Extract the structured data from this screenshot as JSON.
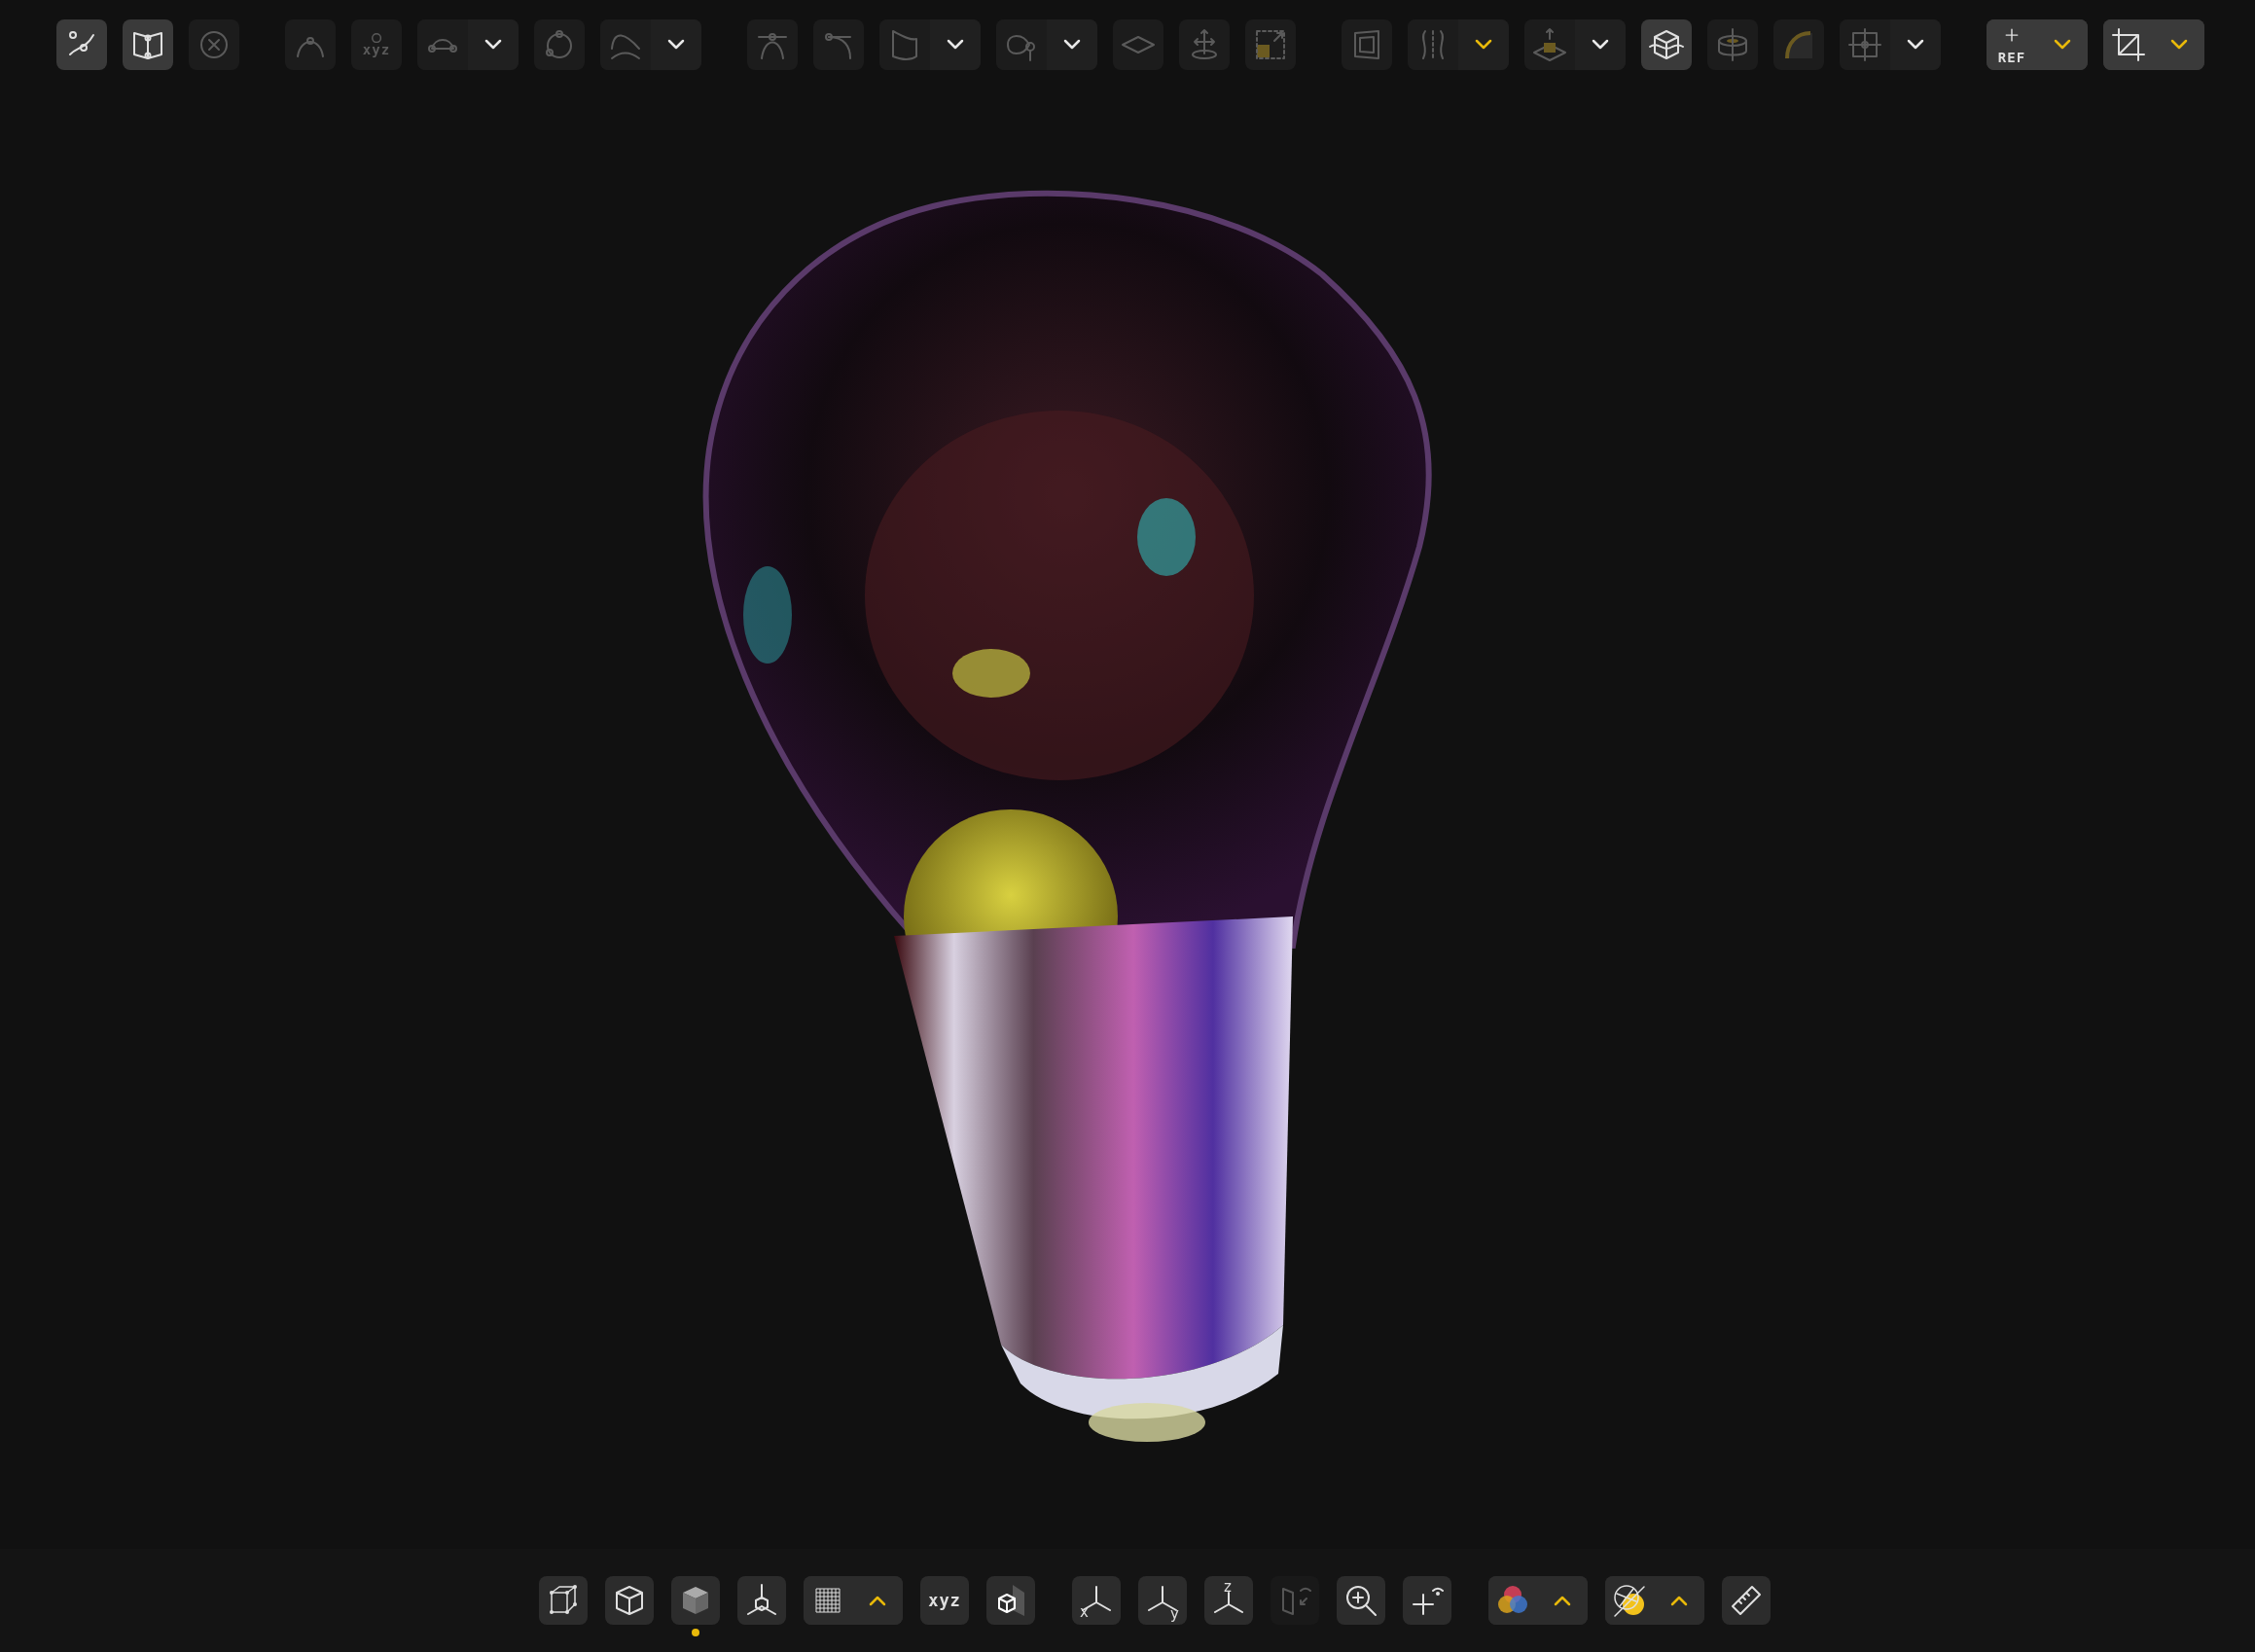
{
  "top_toolbar": {
    "groups": [
      {
        "items": [
          {
            "kind": "tool",
            "active": true
          },
          {
            "kind": "tool",
            "active": true
          },
          {
            "kind": "tool",
            "active": false
          }
        ]
      },
      {
        "items": [
          {
            "kind": "tool",
            "active": false
          },
          {
            "kind": "tool",
            "active": false,
            "label": "xyz"
          },
          {
            "kind": "split",
            "active": false,
            "accent": false
          },
          {
            "kind": "tool",
            "active": false
          },
          {
            "kind": "split",
            "active": false,
            "accent": false
          }
        ]
      },
      {
        "items": [
          {
            "kind": "tool",
            "active": false
          },
          {
            "kind": "tool",
            "active": false
          },
          {
            "kind": "split",
            "active": false,
            "accent": false
          },
          {
            "kind": "split",
            "active": false,
            "accent": false
          },
          {
            "kind": "tool",
            "active": false
          },
          {
            "kind": "tool",
            "active": false
          },
          {
            "kind": "tool",
            "active": false
          }
        ]
      },
      {
        "items": [
          {
            "kind": "tool",
            "active": false
          },
          {
            "kind": "split",
            "active": false,
            "accent": true
          },
          {
            "kind": "split",
            "active": false,
            "accent": false
          },
          {
            "kind": "tool",
            "active": true
          },
          {
            "kind": "tool",
            "active": false
          },
          {
            "kind": "tool",
            "active": false
          },
          {
            "kind": "split",
            "active": false,
            "accent": false
          }
        ]
      },
      {
        "items": [
          {
            "kind": "split",
            "active": true,
            "accent": true,
            "label": "REF"
          },
          {
            "kind": "split",
            "active": true,
            "accent": true
          }
        ]
      }
    ]
  },
  "bottom_toolbar": {
    "groups": [
      {
        "items": [
          {
            "kind": "tool",
            "selected": false,
            "disabled": false
          },
          {
            "kind": "tool",
            "selected": false,
            "disabled": false
          },
          {
            "kind": "tool",
            "selected": true,
            "disabled": false
          },
          {
            "kind": "tool",
            "selected": false,
            "disabled": false
          },
          {
            "kind": "split",
            "selected": false,
            "disabled": false
          },
          {
            "kind": "text",
            "label": "xyz",
            "selected": false,
            "disabled": false
          },
          {
            "kind": "tool",
            "selected": false,
            "disabled": false
          }
        ]
      },
      {
        "items": [
          {
            "kind": "axis",
            "label": "x",
            "selected": false,
            "disabled": false
          },
          {
            "kind": "axis",
            "label": "y",
            "selected": false,
            "disabled": false
          },
          {
            "kind": "axis",
            "label": "z",
            "selected": false,
            "disabled": false
          },
          {
            "kind": "tool",
            "selected": false,
            "disabled": true
          },
          {
            "kind": "tool",
            "selected": false,
            "disabled": false
          },
          {
            "kind": "tool",
            "selected": false,
            "disabled": false
          }
        ]
      },
      {
        "items": [
          {
            "kind": "split",
            "selected": false,
            "disabled": false
          },
          {
            "kind": "split",
            "selected": false,
            "disabled": false
          },
          {
            "kind": "tool",
            "selected": false,
            "disabled": false
          }
        ]
      }
    ]
  }
}
